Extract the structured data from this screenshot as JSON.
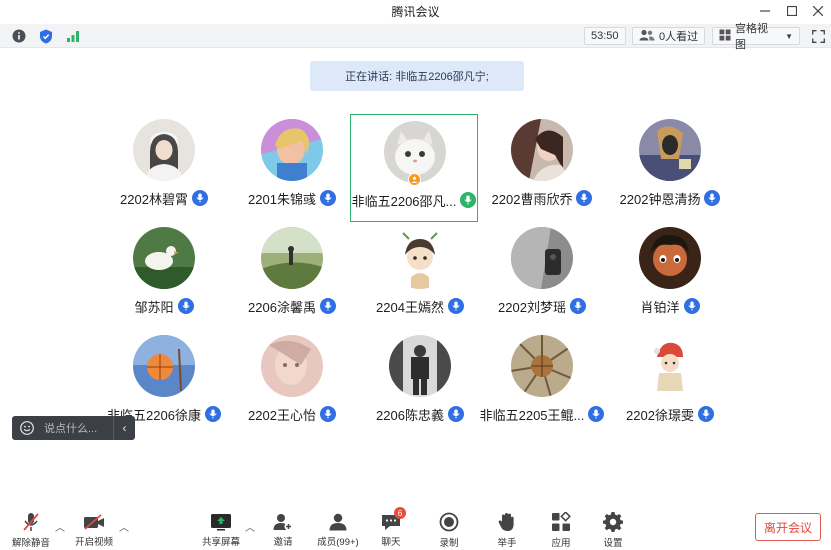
{
  "window": {
    "title": "腾讯会议"
  },
  "infobar": {
    "timer": "53:50",
    "viewers": "0人看过",
    "view_mode": "宫格视图"
  },
  "speaking_banner": "正在讲话: 非临五2206邵凡宁;",
  "participants": [
    {
      "name": "2202林碧霄"
    },
    {
      "name": "2201朱锦彧"
    },
    {
      "name": "非临五2206邵凡..."
    },
    {
      "name": "2202曹雨欣乔"
    },
    {
      "name": "2202钟恩清扬"
    },
    {
      "name": "邹苏阳"
    },
    {
      "name": "2206涂馨禹"
    },
    {
      "name": "2204王嫣然"
    },
    {
      "name": "2202刘梦瑶"
    },
    {
      "name": "肖铂洋"
    },
    {
      "name": "非临五2206徐康"
    },
    {
      "name": "2202王心怡"
    },
    {
      "name": "2206陈忠義"
    },
    {
      "name": "非临五2205王鲲..."
    },
    {
      "name": "2202徐璟雯"
    }
  ],
  "chat": {
    "placeholder": "说点什么..."
  },
  "toolbar": {
    "unmute": "解除静音",
    "start_video": "开启视频",
    "share_screen": "共享屏幕",
    "invite": "邀请",
    "members": "成员(99+)",
    "chat": "聊天",
    "chat_badge": "6",
    "record": "录制",
    "raise_hand": "举手",
    "apps": "应用",
    "settings": "设置",
    "leave": "离开会议"
  },
  "colors": {
    "accent_blue": "#2f6fe4",
    "speaking_green": "#2db46a",
    "leave_red": "#e04a3e",
    "banner_bg": "#dde9f9"
  }
}
